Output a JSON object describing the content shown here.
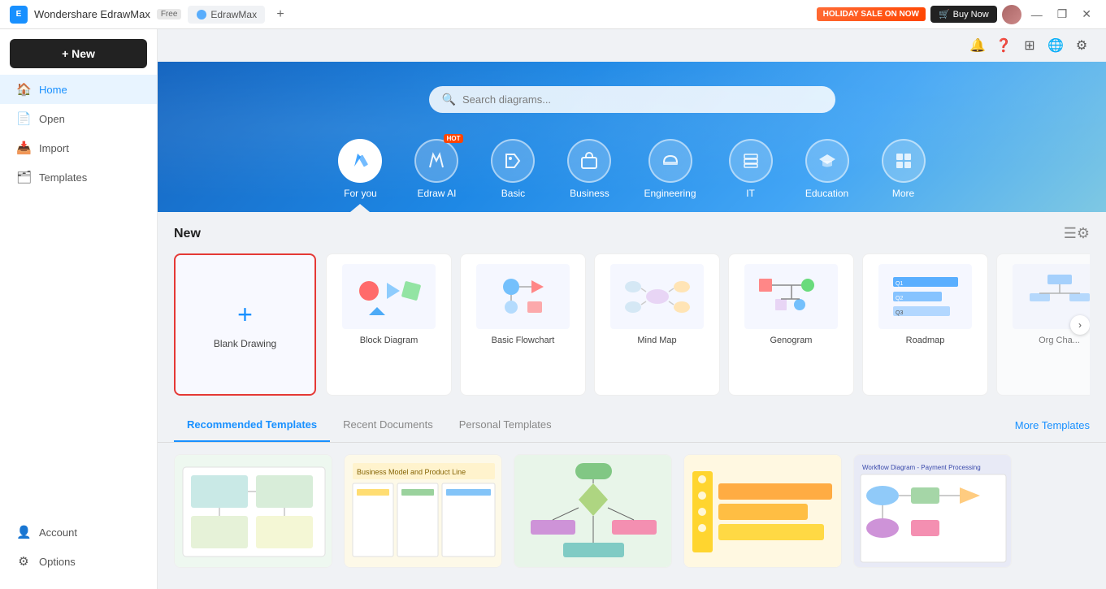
{
  "titlebar": {
    "app_name": "Wondershare EdrawMax",
    "badge": "Free",
    "tab_label": "EdrawMax",
    "add_tab_label": "+",
    "sale_text": "HOLIDAY SALE ON NOW",
    "buy_now": "Buy Now",
    "win_min": "—",
    "win_max": "❐",
    "win_close": "✕"
  },
  "sidebar": {
    "new_btn": "+ New",
    "items": [
      {
        "id": "home",
        "label": "Home",
        "icon": "🏠",
        "active": true
      },
      {
        "id": "open",
        "label": "Open",
        "icon": "📄"
      },
      {
        "id": "import",
        "label": "Import",
        "icon": "📥"
      },
      {
        "id": "templates",
        "label": "Templates",
        "icon": "🗂"
      }
    ],
    "bottom_items": [
      {
        "id": "account",
        "label": "Account",
        "icon": "👤"
      },
      {
        "id": "options",
        "label": "Options",
        "icon": "⚙"
      }
    ]
  },
  "hero": {
    "search_placeholder": "Search diagrams...",
    "categories": [
      {
        "id": "for-you",
        "label": "For you",
        "icon": "✏",
        "active": true,
        "hot": false
      },
      {
        "id": "edraw-ai",
        "label": "Edraw AI",
        "icon": "✦",
        "active": false,
        "hot": true
      },
      {
        "id": "basic",
        "label": "Basic",
        "icon": "🏷",
        "active": false,
        "hot": false
      },
      {
        "id": "business",
        "label": "Business",
        "icon": "💼",
        "active": false,
        "hot": false
      },
      {
        "id": "engineering",
        "label": "Engineering",
        "icon": "⛑",
        "active": false,
        "hot": false
      },
      {
        "id": "it",
        "label": "IT",
        "icon": "▦",
        "active": false,
        "hot": false
      },
      {
        "id": "education",
        "label": "Education",
        "icon": "🎓",
        "active": false,
        "hot": false
      },
      {
        "id": "more",
        "label": "More",
        "icon": "⊞",
        "active": false,
        "hot": false
      }
    ]
  },
  "new_section": {
    "title": "New",
    "blank_label": "Blank Drawing",
    "templates": [
      {
        "id": "block-diagram",
        "name": "Block Diagram"
      },
      {
        "id": "basic-flowchart",
        "name": "Basic Flowchart"
      },
      {
        "id": "mind-map",
        "name": "Mind Map"
      },
      {
        "id": "genogram",
        "name": "Genogram"
      },
      {
        "id": "roadmap",
        "name": "Roadmap"
      },
      {
        "id": "org-chart",
        "name": "Org Cha..."
      }
    ]
  },
  "recommended_tabs": [
    {
      "id": "recommended",
      "label": "Recommended Templates",
      "active": true
    },
    {
      "id": "recent",
      "label": "Recent Documents",
      "active": false
    },
    {
      "id": "personal",
      "label": "Personal Templates",
      "active": false
    }
  ],
  "more_templates_label": "More Templates",
  "gallery_items": [
    {
      "id": "g1",
      "bg": "#e8f0f8"
    },
    {
      "id": "g2",
      "bg": "#fef9e7"
    },
    {
      "id": "g3",
      "bg": "#edf7ed"
    },
    {
      "id": "g4",
      "bg": "#fdf0e8"
    },
    {
      "id": "g5",
      "bg": "#f0e8fd"
    }
  ],
  "topbar_icons": {
    "bell": "🔔",
    "help": "❓",
    "grid": "⊞",
    "community": "🌐",
    "settings": "⚙"
  }
}
